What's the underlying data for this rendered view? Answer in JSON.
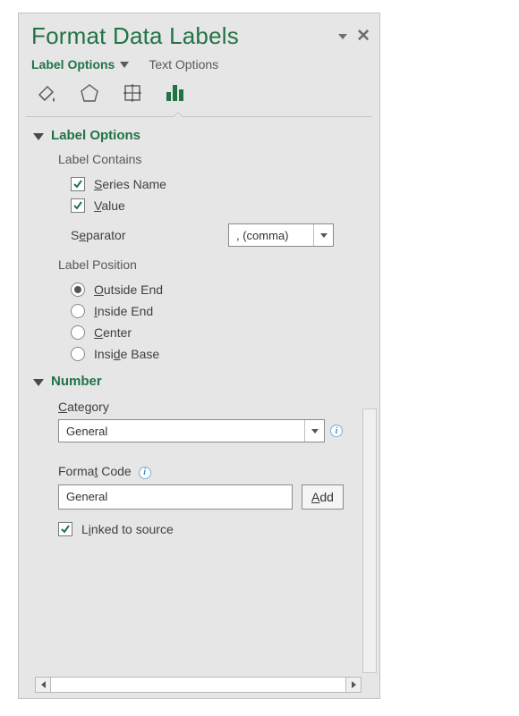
{
  "title": "Format Data Labels",
  "tabs": {
    "options": "Label Options",
    "text": "Text Options"
  },
  "section_label_options": "Label Options",
  "label_contains": "Label Contains",
  "series_name": "Series Name",
  "value": "Value",
  "separator": "Separator",
  "separator_value": ", (comma)",
  "label_position": "Label Position",
  "pos": {
    "outside_end": "Outside End",
    "inside_end": "Inside End",
    "center": "Center",
    "inside_base": "Inside Base"
  },
  "section_number": "Number",
  "category": "Category",
  "category_value": "General",
  "format_code": "Format Code",
  "format_code_value": "General",
  "add": "Add",
  "linked": "Linked to source"
}
